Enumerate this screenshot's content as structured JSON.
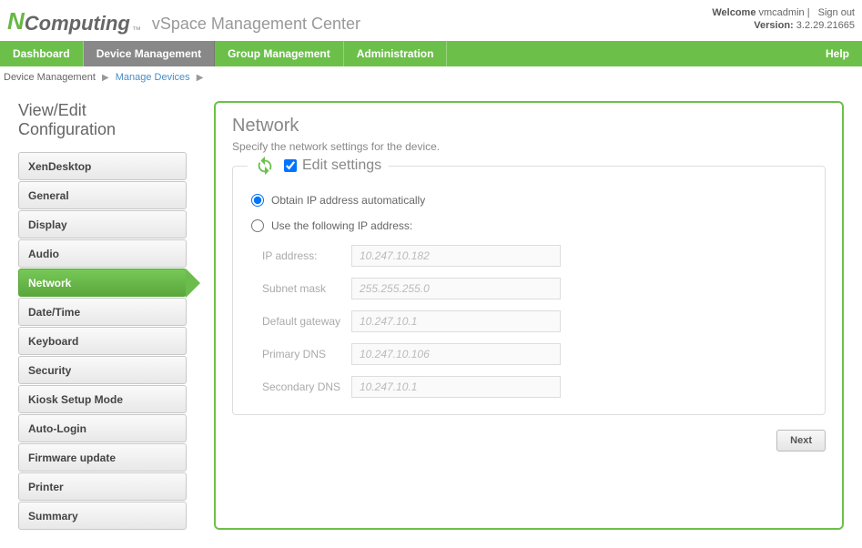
{
  "header": {
    "logo_first_letter": "N",
    "logo_rest": "Computing",
    "logo_tm": "™",
    "app_title": "vSpace Management Center",
    "welcome_label": "Welcome",
    "username": "vmcadmin",
    "signout": "Sign out",
    "version_label": "Version:",
    "version_value": "3.2.29.21665"
  },
  "nav": {
    "items": [
      {
        "label": "Dashboard",
        "active": false
      },
      {
        "label": "Device Management",
        "active": true
      },
      {
        "label": "Group Management",
        "active": false
      },
      {
        "label": "Administration",
        "active": false
      }
    ],
    "help": "Help"
  },
  "breadcrumb": {
    "item1": "Device Management",
    "item2": "Manage Devices"
  },
  "page_title": "View/Edit Configuration",
  "sidebar": {
    "items": [
      {
        "label": "XenDesktop",
        "active": false
      },
      {
        "label": "General",
        "active": false
      },
      {
        "label": "Display",
        "active": false
      },
      {
        "label": "Audio",
        "active": false
      },
      {
        "label": "Network",
        "active": true
      },
      {
        "label": "Date/Time",
        "active": false
      },
      {
        "label": "Keyboard",
        "active": false
      },
      {
        "label": "Security",
        "active": false
      },
      {
        "label": "Kiosk Setup Mode",
        "active": false
      },
      {
        "label": "Auto-Login",
        "active": false
      },
      {
        "label": "Firmware update",
        "active": false
      },
      {
        "label": "Printer",
        "active": false
      },
      {
        "label": "Summary",
        "active": false
      }
    ]
  },
  "panel": {
    "title": "Network",
    "description": "Specify the network settings for the device.",
    "legend": "Edit settings",
    "radio_auto": "Obtain IP address automatically",
    "radio_manual": "Use the following IP address:",
    "fields": {
      "ip_label": "IP address:",
      "ip_value": "10.247.10.182",
      "subnet_label": "Subnet mask",
      "subnet_value": "255.255.255.0",
      "gateway_label": "Default gateway",
      "gateway_value": "10.247.10.1",
      "dns1_label": "Primary DNS",
      "dns1_value": "10.247.10.106",
      "dns2_label": "Secondary DNS",
      "dns2_value": "10.247.10.1"
    },
    "next_button": "Next"
  }
}
